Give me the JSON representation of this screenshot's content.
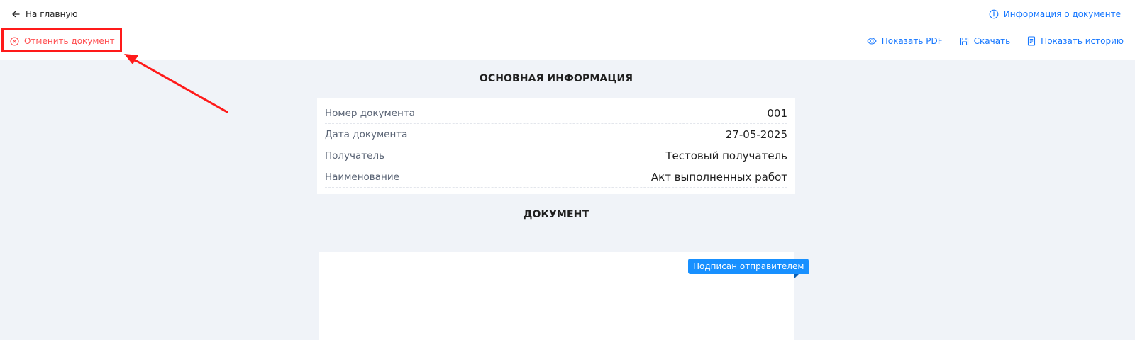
{
  "header": {
    "back_label": "На главную",
    "info_label": "Информация о документе",
    "cancel_label": "Отменить документ"
  },
  "actions": {
    "show_pdf": "Показать PDF",
    "download": "Скачать",
    "show_history": "Показать историю"
  },
  "main_info": {
    "title": "ОСНОВНАЯ ИНФОРМАЦИЯ",
    "rows": [
      {
        "label": "Номер документа",
        "value": "001"
      },
      {
        "label": "Дата документа",
        "value": "27-05-2025"
      },
      {
        "label": "Получатель",
        "value": "Тестовый получатель"
      },
      {
        "label": "Наименование",
        "value": "Акт выполненных работ"
      }
    ]
  },
  "document": {
    "title": "ДОКУМЕНТ",
    "status_badge": "Подписан отправителем"
  },
  "colors": {
    "accent": "#1677ff",
    "danger": "#ff4d4f",
    "annotation": "#ff1a1a",
    "badge": "#1890ff",
    "background": "#f0f3f8"
  },
  "icons": {
    "back": "arrow-left-icon",
    "info": "info-circle-icon",
    "cancel": "close-circle-icon",
    "pdf": "eye-icon",
    "download": "save-icon",
    "history": "document-list-icon"
  }
}
